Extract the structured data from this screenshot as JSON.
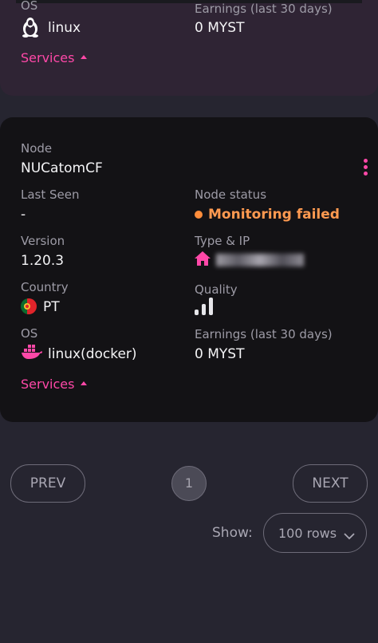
{
  "prev_card": {
    "os_label": "OS",
    "os_value": "linux",
    "earnings_label": "Earnings (last 30 days)",
    "earnings_value": "0 MYST",
    "services_label": "Services"
  },
  "node_card": {
    "node_label": "Node",
    "node_name": "NUCatomCF",
    "last_seen_label": "Last Seen",
    "last_seen_value": "-",
    "status_label": "Node status",
    "status_value": "Monitoring failed",
    "version_label": "Version",
    "version_value": "1.20.3",
    "type_ip_label": "Type & IP",
    "country_label": "Country",
    "country_value": "PT",
    "quality_label": "Quality",
    "os_label": "OS",
    "os_value": "linux(docker)",
    "earnings_label": "Earnings (last 30 days)",
    "earnings_value": "0 MYST",
    "services_label": "Services"
  },
  "pagination": {
    "prev_label": "PREV",
    "current_page": "1",
    "next_label": "NEXT"
  },
  "rows_per_page": {
    "show_label": "Show:",
    "selected": "100 rows"
  },
  "colors": {
    "accent": "#ff48a8",
    "status_warning": "#ff8d3b",
    "card_bg": "#131215",
    "page_bg": "#262530"
  },
  "icons": {
    "linux_os": "tux-icon",
    "docker_os": "docker-icon",
    "home_type": "home-icon",
    "country_flag": "portugal-flag-icon",
    "quality": "signal-bars-icon",
    "menu": "kebab-menu-icon"
  }
}
